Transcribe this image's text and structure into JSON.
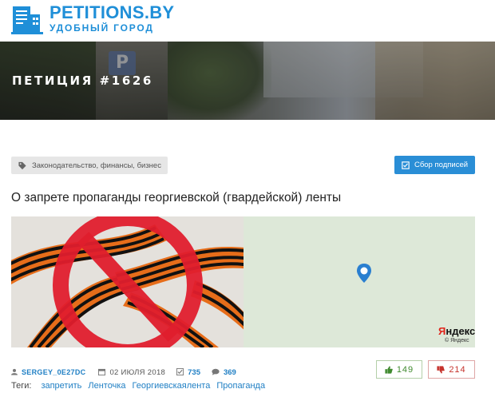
{
  "site": {
    "title": "PETITIONS.BY",
    "subtitle": "УДОБНЫЙ ГОРОД",
    "logo_icon": "building-document-icon"
  },
  "banner": {
    "title": "ПЕТИЦИЯ #1626",
    "sign_text": "P"
  },
  "petition": {
    "category_icon": "tag-icon",
    "category": "Законодательство, финансы, бизнес",
    "collect_button": "Сбор подписей",
    "collect_icon": "check-square-icon",
    "title": "О запрете пропаганды георгиевской (гвардейской) ленты"
  },
  "map": {
    "provider": "Яндекс",
    "copyright": "© Яндекс",
    "background_color": "#dde8d8"
  },
  "meta": {
    "author": "SERGEY_0E27DC",
    "date": "02 ИЮЛЯ 2018",
    "signatures": "735",
    "comments": "369",
    "user_icon": "user-icon",
    "calendar_icon": "calendar-icon",
    "signatures_icon": "check-icon",
    "comments_icon": "comment-icon"
  },
  "votes": {
    "up": "149",
    "down": "214",
    "up_color": "#3f8a2e",
    "down_color": "#c6322c"
  },
  "tags": {
    "label": "Теги:",
    "items": [
      "запретить",
      "Ленточка",
      "Георгиевскаялента",
      "Пропаганда"
    ]
  },
  "colors": {
    "brand": "#1f8fd8",
    "link": "#1f7fc4",
    "button": "#2a8ed6"
  }
}
